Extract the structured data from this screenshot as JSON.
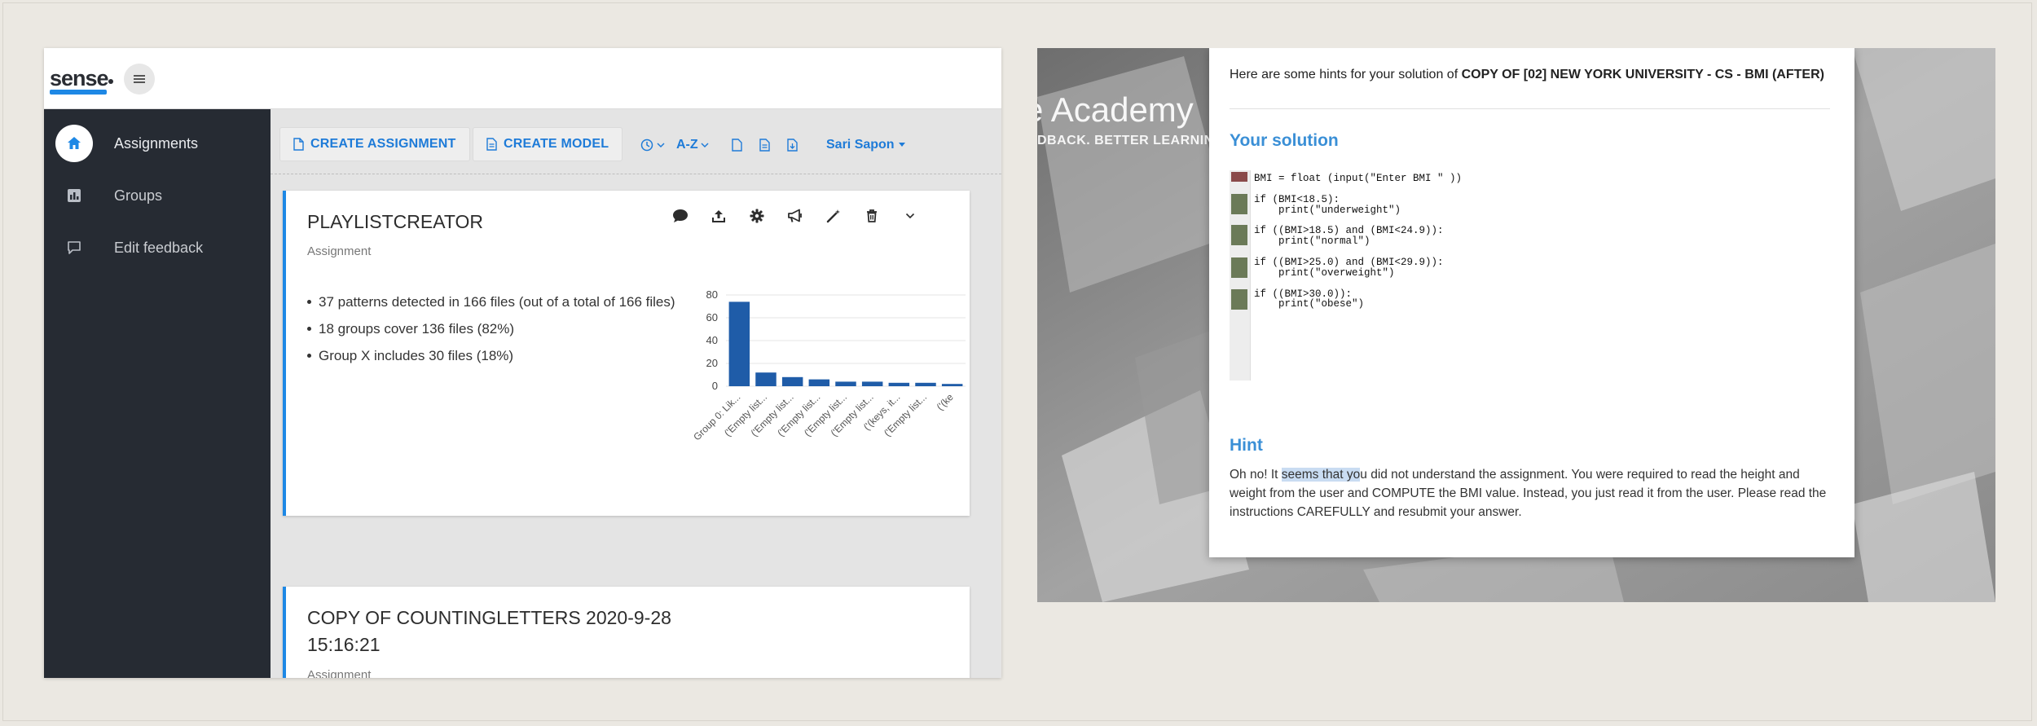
{
  "app": {
    "logo_text": "sense",
    "menu_icon": "hamburger-icon"
  },
  "sidebar": {
    "items": [
      {
        "label": "Assignments",
        "icon": "home-icon"
      },
      {
        "label": "Groups",
        "icon": "bar-chart-icon"
      },
      {
        "label": "Edit feedback",
        "icon": "speech-bubble-icon"
      }
    ]
  },
  "toolbar": {
    "create_assignment": "CREATE ASSIGNMENT",
    "create_model": "CREATE MODEL",
    "sort_label": "A-Z",
    "user_label": "Sari Sapon"
  },
  "cards": [
    {
      "title": "PLAYLISTCREATOR",
      "subtitle": "Assignment",
      "bullets": [
        "37 patterns detected in 166 files (out of a total of 166 files)",
        "18 groups cover 136 files (82%)",
        "Group X includes 30 files (18%)"
      ]
    },
    {
      "title_line1": "COPY OF COUNTINGLETTERS 2020-9-28",
      "title_line2": "15:16:21",
      "subtitle": "Assignment"
    }
  ],
  "chart_data": {
    "type": "bar",
    "categories": [
      "Group 0: Lik...",
      "('Empty list...",
      "('Empty list...",
      "('Empty list...",
      "('Empty list...",
      "('Empty list...",
      "('(keys, it...",
      "('Empty list...",
      "('(ke"
    ],
    "values": [
      74,
      12,
      8,
      6,
      4,
      4,
      3,
      3,
      2
    ],
    "ylim": [
      0,
      80
    ],
    "yticks": [
      "0",
      "20",
      "40",
      "60",
      "80"
    ],
    "grid": true,
    "bar_color": "#1f5ca8"
  },
  "right_panel": {
    "bg_title": "e Academy",
    "bg_subtitle": "DBACK. BETTER LEARNING.",
    "intro": "Here are some hints for your solution of ",
    "intro_bold": "COPY OF [02] NEW YORK UNIVERSITY - CS - BMI (AFTER)",
    "solution_heading": "Your solution",
    "code_lines": [
      "BMI = float (input(\"Enter BMI \" ))",
      "",
      "if (BMI<18.5):",
      "    print(\"underweight\")",
      "",
      "if ((BMI>18.5) and (BMI<24.9)):",
      "    print(\"normal\")",
      "",
      "if ((BMI>25.0) and (BMI<29.9)):",
      "    print(\"overweight\")",
      "",
      "if ((BMI>30.0)):",
      "    print(\"obese\")"
    ],
    "hint_heading": "Hint",
    "hint_pre": "Oh no! It ",
    "hint_highlight": "seems that yo",
    "hint_post": "u did not understand the assignment. You were required to read the height and weight from the user and COMPUTE the BMI value. Instead, you just read it from the user. Please read the instructions CAREFULLY and resubmit your answer.",
    "gutter_colors": {
      "error": "#8a4a4a",
      "ok": "#6b7a58"
    }
  }
}
